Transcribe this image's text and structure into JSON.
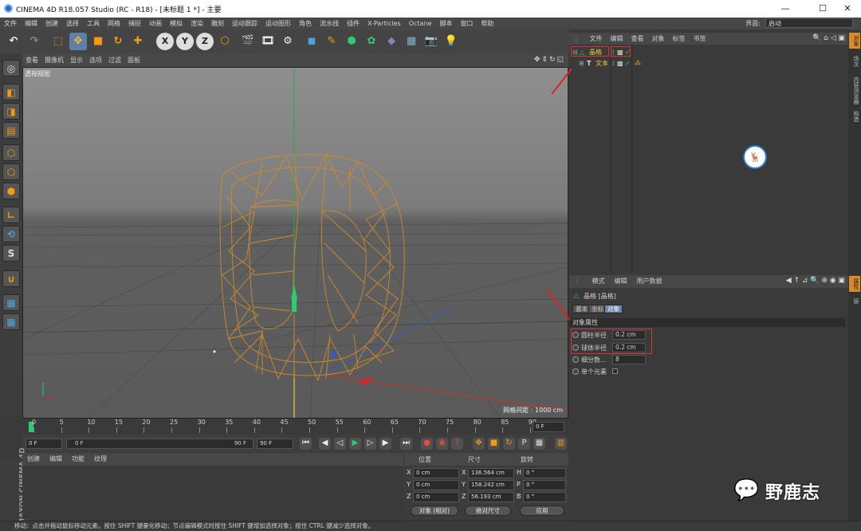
{
  "window": {
    "title": "CINEMA 4D R18.057 Studio (RC - R18) - [未标题 1 *] - 主要",
    "minimize": "—",
    "maximize": "☐",
    "close": "✕"
  },
  "menubar": {
    "items": [
      "文件",
      "编辑",
      "创建",
      "选择",
      "工具",
      "网格",
      "捕捉",
      "动画",
      "模拟",
      "渲染",
      "雕刻",
      "运动跟踪",
      "运动图形",
      "角色",
      "流水线",
      "插件",
      "X-Particles",
      "Octane",
      "脚本",
      "窗口",
      "帮助"
    ],
    "layout_label": "界面:",
    "layout_value": "启动"
  },
  "toolbar": {
    "icons": [
      "undo-icon",
      "redo-icon",
      "live-select-icon",
      "move-icon",
      "scale-icon",
      "rotate-icon",
      "recent-tool-icon",
      "x-axis-lock-icon",
      "y-axis-lock-icon",
      "z-axis-lock-icon",
      "coordinate-system-icon",
      "render-view-icon",
      "render-picture-viewer-icon",
      "render-settings-icon",
      "cube-icon",
      "pen-icon",
      "subdivision-icon",
      "cloner-icon",
      "deformer-icon",
      "floor-icon",
      "camera-icon",
      "light-icon"
    ],
    "axis_labels": [
      "X",
      "Y",
      "Z"
    ]
  },
  "viewport": {
    "menu": [
      "查看",
      "摄像机",
      "显示",
      "选项",
      "过滤",
      "面板"
    ],
    "label": "透视视图",
    "grid_spacing": "网格间距 : 1000 cm"
  },
  "timeline": {
    "ticks": [
      "0",
      "5",
      "10",
      "15",
      "20",
      "25",
      "30",
      "35",
      "40",
      "45",
      "50",
      "55",
      "60",
      "65",
      "70",
      "75",
      "80",
      "85",
      "90"
    ],
    "current_frame": "0 F"
  },
  "playback": {
    "start": "0 F",
    "range_start": "0 F",
    "range_end": "90 F",
    "end": "90 F"
  },
  "materials": {
    "menu": [
      "创建",
      "编辑",
      "功能",
      "纹理"
    ]
  },
  "coords": {
    "headers": [
      "位置",
      "尺寸",
      "旋转"
    ],
    "rows": [
      {
        "axis": "X",
        "pos": "0 cm",
        "size_axis": "X",
        "size": "136.564 cm",
        "rot_axis": "H",
        "rot": "0 °"
      },
      {
        "axis": "Y",
        "pos": "0 cm",
        "size_axis": "Y",
        "size": "158.242 cm",
        "rot_axis": "P",
        "rot": "0 °"
      },
      {
        "axis": "Z",
        "pos": "0 cm",
        "size_axis": "Z",
        "size": "56.193 cm",
        "rot_axis": "B",
        "rot": "0 °"
      }
    ],
    "mode": "对象 (相对)",
    "size_mode": "绝对尺寸",
    "apply": "应用"
  },
  "status": "移动：点击并拖动鼠标移动元素。按住 SHIFT 键量化移动；节点编辑模式时按住 SHIFT 键增加选择对象；按住 CTRL 键减少选择对象。",
  "maxon": "MAXON CINEMA 4D",
  "object_manager": {
    "menu": [
      "文件",
      "编辑",
      "查看",
      "对象",
      "标签",
      "书签"
    ],
    "objects": [
      {
        "name": "晶格",
        "color": "#e8c84a"
      },
      {
        "name": "文本",
        "color": "#e8c84a"
      }
    ]
  },
  "side_tabs": [
    "对象",
    "场次",
    "内容浏览器",
    "构造"
  ],
  "side_tabs_lower": [
    "属性",
    "层"
  ],
  "attribute_manager": {
    "menu": [
      "模式",
      "编辑",
      "用户数据"
    ],
    "object_title": "晶格 [晶格]",
    "tabs": [
      "基本",
      "坐标",
      "对象"
    ],
    "section": "对象属性",
    "params": [
      {
        "label": "圆柱半径",
        "value": "0.2 cm"
      },
      {
        "label": "球体半径",
        "value": "0.2 cm"
      },
      {
        "label": "细分数...",
        "value": "8"
      },
      {
        "label": "单个元素",
        "value": ""
      }
    ]
  },
  "watermark": {
    "text": "野鹿志"
  }
}
